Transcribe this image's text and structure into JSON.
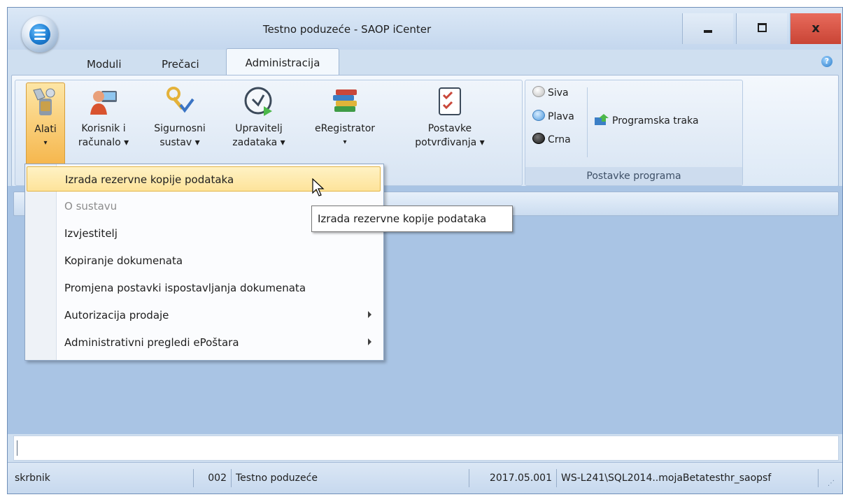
{
  "window": {
    "title": "Testno poduzeće - SAOP iCenter",
    "close_label": "x"
  },
  "tabs": [
    {
      "label": "Moduli"
    },
    {
      "label": "Prečaci"
    },
    {
      "label": "Administracija",
      "active": true
    }
  ],
  "ribbon": {
    "main_group": {
      "buttons": [
        {
          "label1": "Alati",
          "label2": "▾",
          "icon": "tools-icon"
        },
        {
          "label1": "Korisnik i",
          "label2": "računalo ▾",
          "icon": "user-computer-icon"
        },
        {
          "label1": "Sigurnosni",
          "label2": "sustav ▾",
          "icon": "security-keys-icon"
        },
        {
          "label1": "Upravitelj",
          "label2": "zadataka ▾",
          "icon": "task-manager-clock-icon"
        },
        {
          "label1": "eRegistrator",
          "label2": "▾",
          "icon": "registry-books-icon"
        },
        {
          "label1": "Postavke",
          "label2": "potvrđivanja ▾",
          "icon": "checklist-icon"
        }
      ]
    },
    "settings_group": {
      "label": "Postavke programa",
      "themes": [
        {
          "label": "Siva",
          "color": "#d8d8d8"
        },
        {
          "label": "Plava",
          "color": "#5aa7e8"
        },
        {
          "label": "Crna",
          "color": "#1a1a1a"
        }
      ],
      "ribbon_toggle": "Programska traka"
    }
  },
  "menu": {
    "items": [
      {
        "label": "Izrada rezervne kopije podataka",
        "highlighted": true
      },
      {
        "label": "O sustavu",
        "disabled": true
      },
      {
        "label": "Izvjestitelj"
      },
      {
        "label": "Kopiranje dokumenata"
      },
      {
        "label": "Promjena postavki ispostavljanja dokumenata"
      },
      {
        "label": "Autorizacija prodaje",
        "submenu": true
      },
      {
        "label": "Administrativni pregledi ePoštara",
        "submenu": true
      }
    ]
  },
  "tooltip": "Izrada rezervne kopije podataka",
  "status": {
    "user": "skrbnik",
    "company_code": "002",
    "company_name": "Testno poduzeće",
    "version": "2017.05.001",
    "server": "WS-L241\\SQL2014..mojaBetatesthr_saopsf"
  },
  "colors": {
    "accent": "#f5b54a",
    "ribbon_bg": "#dde9f6",
    "workspace": "#a9c4e4"
  }
}
